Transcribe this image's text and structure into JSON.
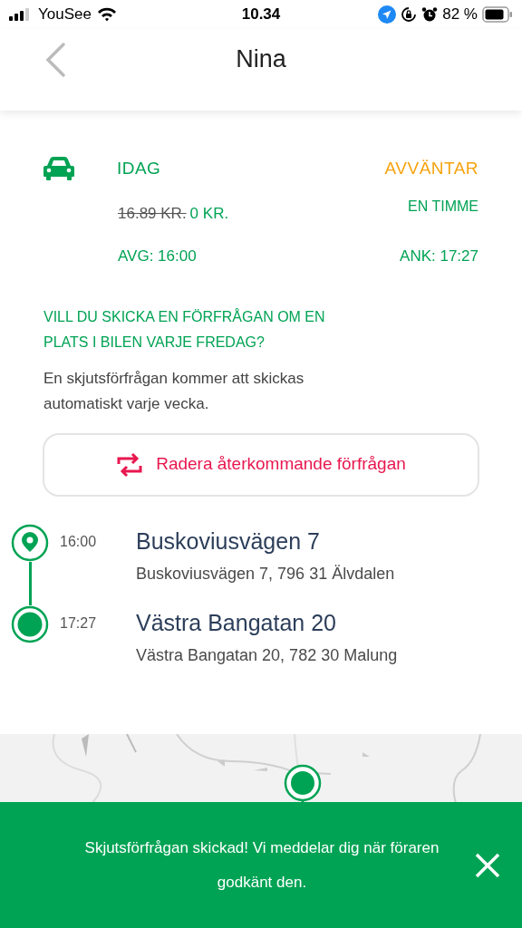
{
  "status_bar": {
    "carrier": "YouSee",
    "time": "10.34",
    "battery": "82 %"
  },
  "header": {
    "title": "Nina"
  },
  "trip": {
    "day": "IDAG",
    "status": "AVVÄNTAR",
    "old_price": "16.89 KR.",
    "price": "0 KR.",
    "duration": "EN TIMME",
    "departure": "AVG: 16:00",
    "arrival": "ANK: 17:27"
  },
  "recurring": {
    "question": "VILL DU SKICKA EN FÖRFRÅGAN OM EN PLATS I BILEN VARJE FREDAG?",
    "info": "En skjutsförfrågan kommer att skickas automatiskt varje vecka.",
    "button": "Radera återkommande förfrågan"
  },
  "stops": [
    {
      "kind": "origin",
      "time": "16:00",
      "name": "Buskoviusvägen 7",
      "address": "Buskoviusvägen 7, 796 31 Älvdalen"
    },
    {
      "kind": "destination",
      "time": "17:27",
      "name": "Västra Bangatan 20",
      "address": "Västra Bangatan 20, 782 30 Malung"
    }
  ],
  "toast": {
    "message": "Skjutsförfrågan skickad! Vi meddelar dig när föraren godkänt den."
  }
}
